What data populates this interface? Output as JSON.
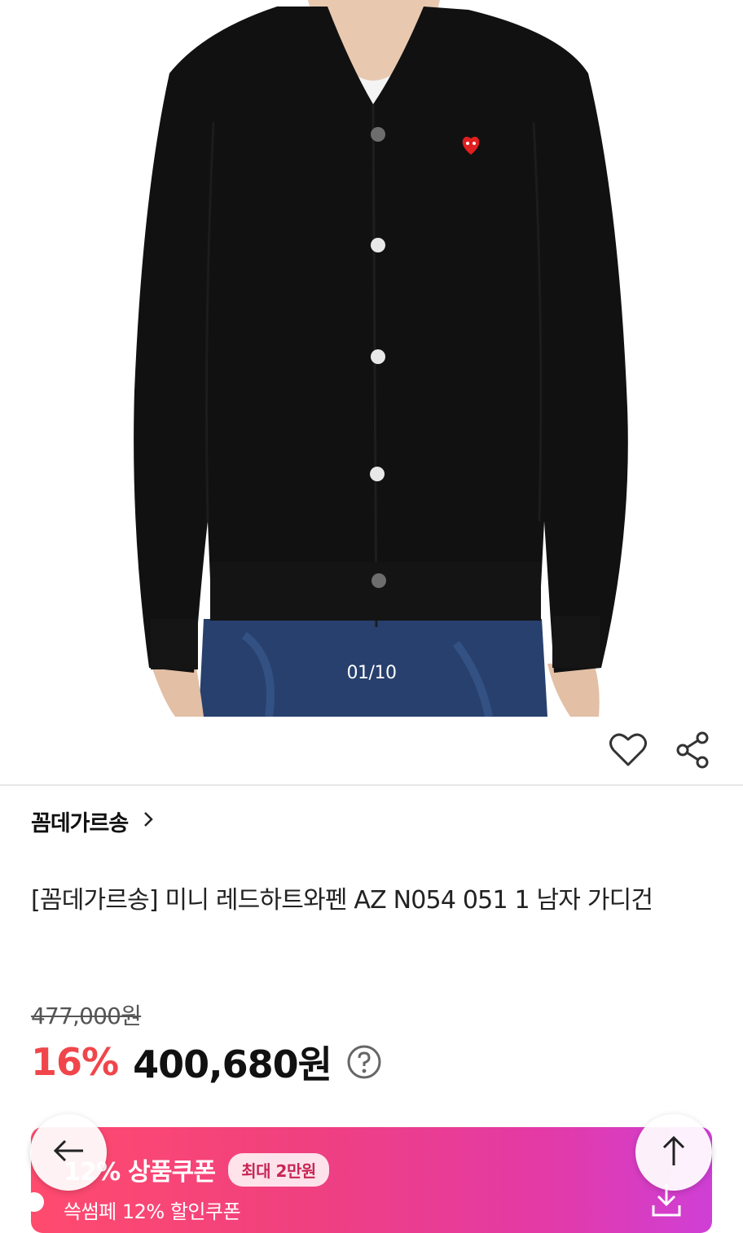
{
  "gallery": {
    "counter": "01/10"
  },
  "actions": {
    "wishlist_icon": "heart-outline-icon",
    "share_icon": "share-icon"
  },
  "brand": {
    "name": "꼼데가르송",
    "chevron_icon": "chevron-right-icon"
  },
  "product": {
    "title": "[꼼데가르송] 미니 레드하트와펜 AZ N054 051 1 남자 가디건"
  },
  "price": {
    "original": "477,000원",
    "discount_rate": "16%",
    "final": "400,680원",
    "help_icon": "question-circle-icon"
  },
  "coupon": {
    "title": "12% 상품쿠폰",
    "badge": "최대 2만원",
    "subtitle": "쓱썸페 12% 할인쿠폰",
    "download_icon": "download-icon"
  },
  "floating": {
    "back_icon": "arrow-left-icon",
    "top_icon": "arrow-up-icon"
  },
  "colors": {
    "discount": "#f0464b",
    "coupon_gradient_start": "#ff4b6e",
    "coupon_gradient_end": "#cf3fd6"
  }
}
